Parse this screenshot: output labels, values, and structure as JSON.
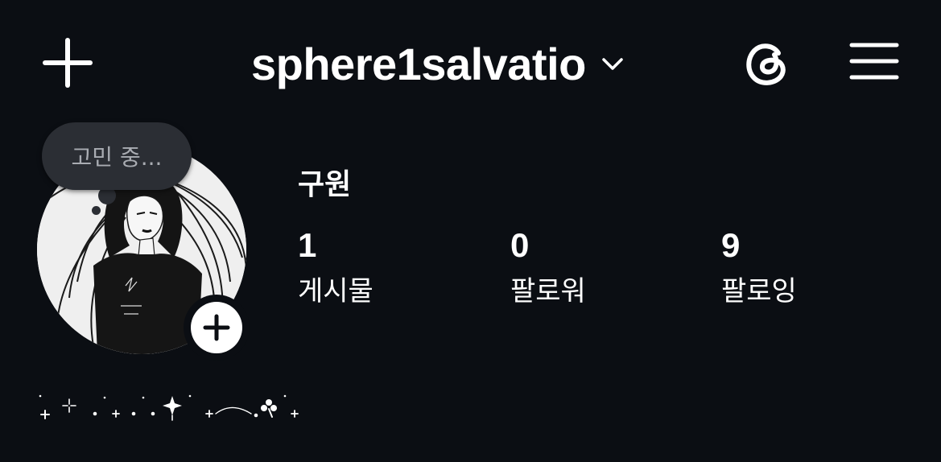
{
  "header": {
    "username": "sphere1salvatio",
    "icons": {
      "create": "plus-icon",
      "switch_account": "chevron-down-icon",
      "threads": "threads-icon",
      "menu": "hamburger-menu-icon"
    }
  },
  "profile": {
    "note": "고민 중...",
    "display_name": "구원",
    "stats": [
      {
        "value": "1",
        "label": "게시물"
      },
      {
        "value": "0",
        "label": "팔로워"
      },
      {
        "value": "9",
        "label": "팔로잉"
      }
    ],
    "bio": "⁺ ⊹ .⁺ . .✦ ⁺⁀ .☘ ⁺"
  },
  "colors": {
    "background": "#0b0e13",
    "text": "#ffffff",
    "note_bubble": "#2b2e34",
    "note_text": "#a9acb2"
  }
}
